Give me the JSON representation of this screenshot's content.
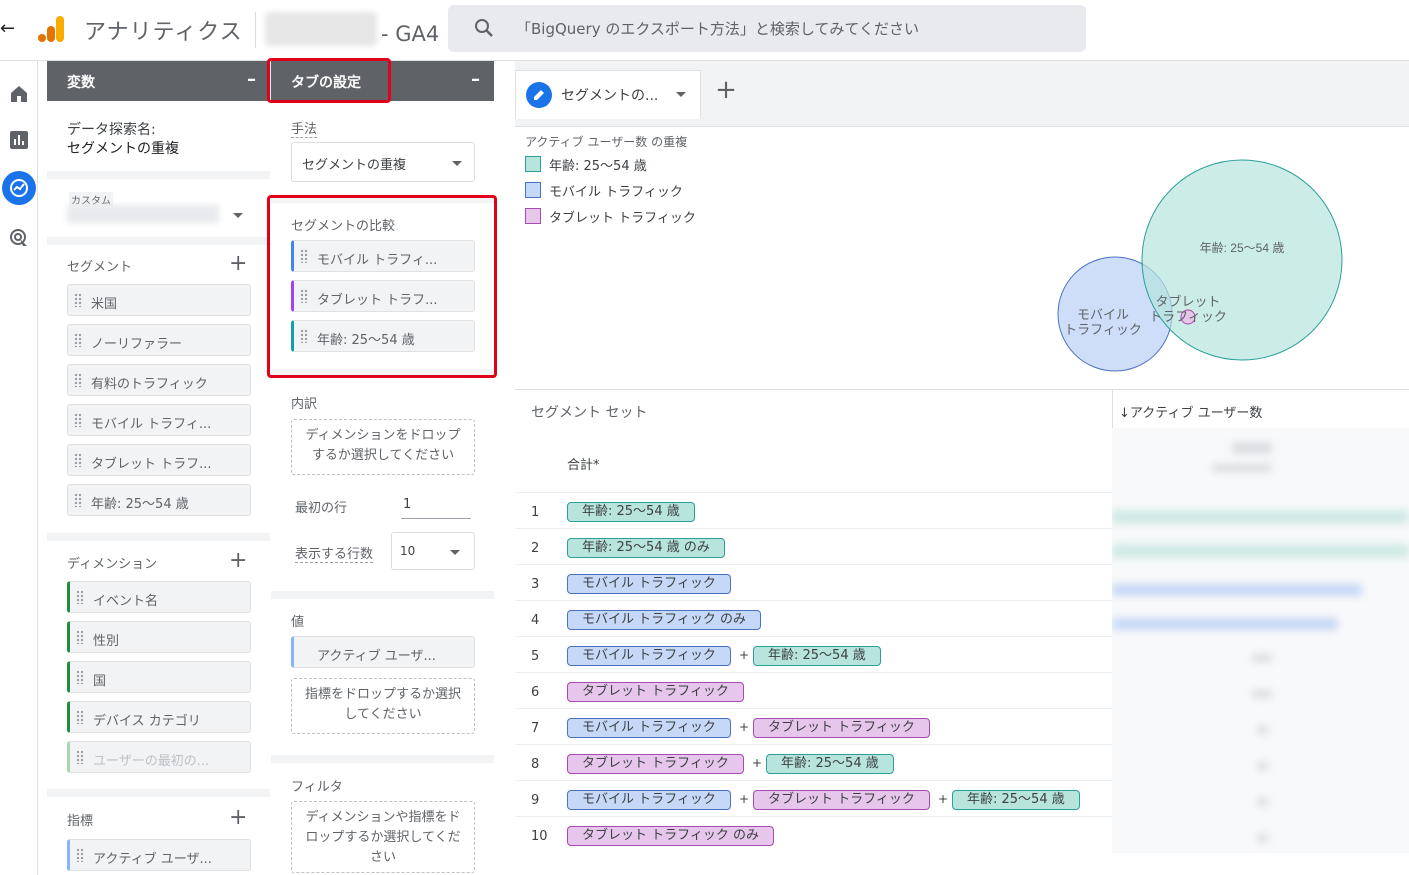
{
  "topbar": {
    "back_icon": "arrow-left-icon",
    "app_title": "アナリティクス",
    "property_suffix": "- GA4",
    "search_placeholder": "「BigQuery のエクスポート方法」と検索してみてください"
  },
  "leftnav": {
    "items": [
      "home-icon",
      "reports-icon",
      "explore-icon",
      "advertising-icon"
    ],
    "active": "explore-icon"
  },
  "variables_panel": {
    "title": "変数",
    "minimize": "–",
    "exploration_name_label": "データ探索名:",
    "exploration_name": "セグメントの重複",
    "date_label": "カスタム",
    "segments_label": "セグメント",
    "segments": [
      "米国",
      "ノーリファラー",
      "有料のトラフィック",
      "モバイル トラフィ...",
      "タブレット トラフ...",
      "年齢: 25〜54 歳"
    ],
    "dimensions_label": "ディメンション",
    "dimensions": [
      "イベント名",
      "性別",
      "国",
      "デバイス カテゴリ",
      "ユーザーの最初の..."
    ],
    "metrics_label": "指標",
    "metrics": [
      "アクティブ ユーザ..."
    ]
  },
  "tab_panel": {
    "title": "タブの設定",
    "minimize": "–",
    "technique_label": "手法",
    "technique_value": "セグメントの重複",
    "segment_compare_label": "セグメントの比較",
    "segment_compare": [
      "モバイル トラフィ...",
      "タブレット トラフ...",
      "年齢: 25〜54 歳"
    ],
    "breakdown_label": "内訳",
    "breakdown_drop": "ディメンションをドロップするか選択してください",
    "first_row_label": "最初の行",
    "first_row_value": "1",
    "rows_shown_label": "表示する行数",
    "rows_shown_value": "10",
    "values_label": "値",
    "values_chip": "アクティブ ユーザ...",
    "values_drop": "指標をドロップするか選択してください",
    "filter_label": "フィルタ",
    "filter_drop": "ディメンションや指標をドロップするか選択してください"
  },
  "main": {
    "tab_label": "セグメントの...",
    "add_tab": "+",
    "viz_title": "アクティブ ユーザー数 の重複",
    "legend": [
      {
        "label": "年齢: 25〜54 歳",
        "color": "#b7e4dd",
        "border": "#2aa198"
      },
      {
        "label": "モバイル トラフィック",
        "color": "#c6d8f7",
        "border": "#4a72c4"
      },
      {
        "label": "タブレット トラフィック",
        "color": "#e7c6ec",
        "border": "#a64bb0"
      }
    ],
    "venn_labels": {
      "age": "年齢: 25〜54 歳",
      "mobile_line1": "モバイル",
      "mobile_line2": "トラフィック",
      "tablet_line1": "タブレット",
      "tablet_line2": "トラフィック"
    },
    "table": {
      "col_segment": "セグメント セット",
      "col_metric": "↓アクティブ ユーザー数",
      "total_label": "合計*",
      "rows": [
        {
          "idx": "1",
          "pills": [
            {
              "t": "年齢: 25〜54 歳",
              "c": "teal"
            }
          ]
        },
        {
          "idx": "2",
          "pills": [
            {
              "t": "年齢: 25〜54 歳 のみ",
              "c": "teal"
            }
          ]
        },
        {
          "idx": "3",
          "pills": [
            {
              "t": "モバイル トラフィック",
              "c": "blue"
            }
          ]
        },
        {
          "idx": "4",
          "pills": [
            {
              "t": "モバイル トラフィック のみ",
              "c": "blue"
            }
          ]
        },
        {
          "idx": "5",
          "pills": [
            {
              "t": "モバイル トラフィック",
              "c": "blue"
            },
            {
              "t": "年齢: 25〜54 歳",
              "c": "teal"
            }
          ]
        },
        {
          "idx": "6",
          "pills": [
            {
              "t": "タブレット トラフィック",
              "c": "purple"
            }
          ]
        },
        {
          "idx": "7",
          "pills": [
            {
              "t": "モバイル トラフィック",
              "c": "blue"
            },
            {
              "t": "タブレット トラフィック",
              "c": "purple"
            }
          ]
        },
        {
          "idx": "8",
          "pills": [
            {
              "t": "タブレット トラフィック",
              "c": "purple"
            },
            {
              "t": "年齢: 25〜54 歳",
              "c": "teal"
            }
          ]
        },
        {
          "idx": "9",
          "pills": [
            {
              "t": "モバイル トラフィック",
              "c": "blue"
            },
            {
              "t": "タブレット トラフィック",
              "c": "purple"
            },
            {
              "t": "年齢: 25〜54 歳",
              "c": "teal"
            }
          ]
        },
        {
          "idx": "10",
          "pills": [
            {
              "t": "タブレット トラフィック のみ",
              "c": "purple"
            }
          ]
        }
      ]
    }
  }
}
